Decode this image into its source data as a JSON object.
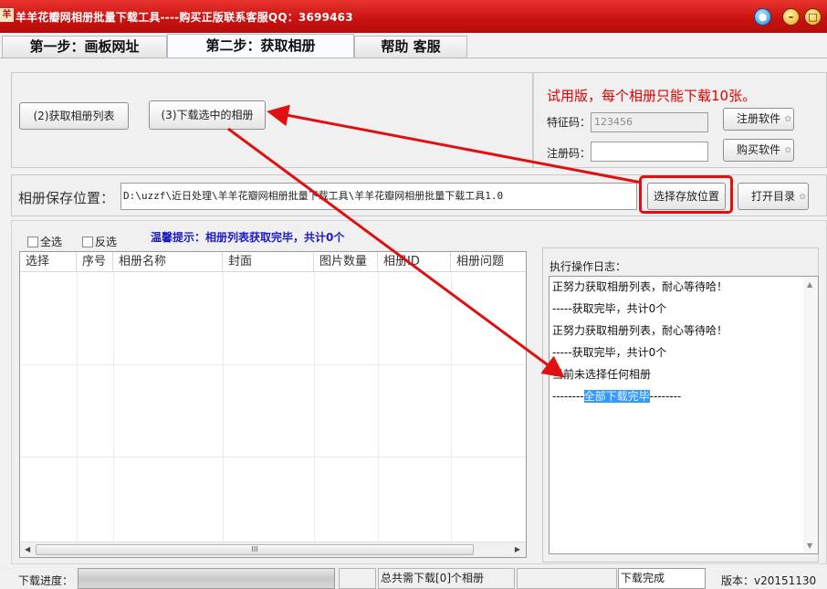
{
  "window": {
    "app_icon_text": "羊",
    "title": "羊羊花瓣网相册批量下载工具----购买正版联系客服QQ：3699463",
    "skin_glyph": "●",
    "minimize_glyph": "–",
    "maximize_glyph": "□",
    "close_glyph": "×"
  },
  "tabs": [
    {
      "label": "第一步：画板网址"
    },
    {
      "label": "第二步：获取相册"
    },
    {
      "label": "帮助 客服"
    }
  ],
  "actions": {
    "get_list_label": "(2)获取相册列表",
    "download_selected_label": "(3)下载选中的相册"
  },
  "register": {
    "trial_notice": "试用版，每个相册只能下载10张。",
    "feature_code_label": "特征码：",
    "feature_code_value": "123456",
    "register_code_label": "注册码：",
    "register_code_value": "",
    "register_button": "注册软件",
    "buy_button": "购买软件"
  },
  "save": {
    "label": "相册保存位置：",
    "path": "D:\\uzzf\\近日处理\\羊羊花瓣网相册批量下载工具\\羊羊花瓣网相册批量下载工具1.0",
    "choose_button": "选择存放位置",
    "open_button": "打开目录"
  },
  "list": {
    "select_all": "全选",
    "invert": "反选",
    "tip": "温馨提示：相册列表获取完毕，共计0个",
    "columns": [
      "选择",
      "序号",
      "相册名称",
      "封面",
      "图片数量",
      "相册ID",
      "相册问题"
    ],
    "rows": [],
    "scroll_left": "◀",
    "scroll_right": "▶",
    "scroll_grip": "III"
  },
  "log": {
    "title": "执行操作日志：",
    "lines": [
      "正努力获取相册列表，耐心等待哈！",
      "-----获取完毕，共计0个",
      "正努力获取相册列表，耐心等待哈！",
      "-----获取完毕，共计0个",
      "当前未选择任何相册"
    ],
    "final_prefix": "--------",
    "final_highlight": "全部下载完毕",
    "final_suffix": "--------",
    "scroll_up": "▲",
    "scroll_down": "▼"
  },
  "status": {
    "progress_label": "下载进度：",
    "progress": 0,
    "total_text": "总共需下载[0]个相册",
    "state_text": "下载完成",
    "version_text": "版本：v20151130"
  },
  "colors": {
    "title_bar": "#c8110f",
    "trial_text": "#e00000",
    "tip_text": "#1c1cbe",
    "annotation": "#e01010",
    "selection": "#3399ff"
  }
}
